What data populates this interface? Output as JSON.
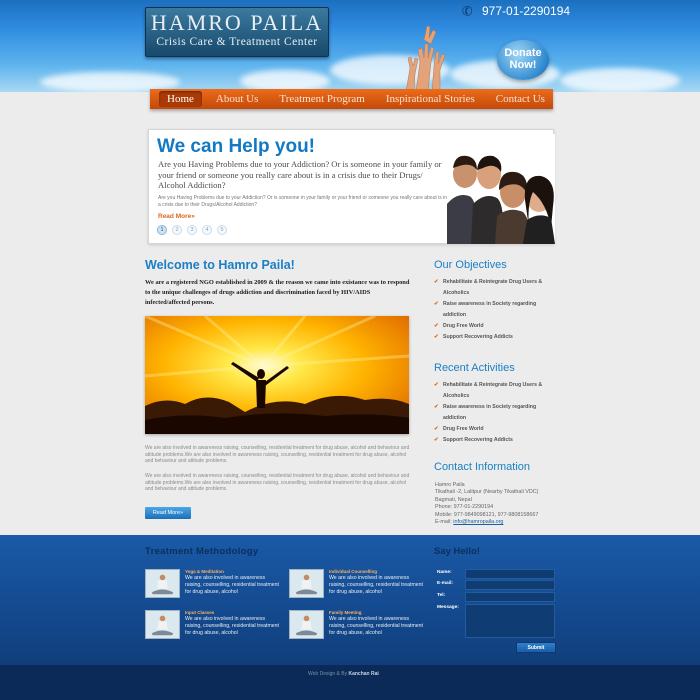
{
  "header": {
    "logo_title": "HAMRO PAILA",
    "logo_subtitle": "Crisis Care & Treatment Center",
    "phone": "977-01-2290194",
    "donate_label": "Donate Now!"
  },
  "nav": {
    "items": [
      {
        "label": "Home",
        "active": true
      },
      {
        "label": "About Us"
      },
      {
        "label": "Treatment Program"
      },
      {
        "label": "Inspirational Stories"
      },
      {
        "label": "Contact Us"
      }
    ]
  },
  "hero": {
    "title": "We can Help you!",
    "lead": "Are you Having Problems due to your Addiction? Or is someone in your family or your friend or someone you really care about is in a crisis due to their Drugs/ Alcohol Addiction?",
    "small": "Are you Having Problems due to your Addiction? Or is someone in your family or your friend or someone you really care about is in a crisis due to their Drugs/Alcohol Addiction?",
    "read_more": "Read More»",
    "pages": [
      "1",
      "2",
      "3",
      "4",
      "5"
    ]
  },
  "welcome": {
    "title": "Welcome to Hamro Paila!",
    "intro": "We are a registered NGO established in 2009 & the reason we came into existance was to respond to the unique challenges of drugs addiction and discrimination faced by HIV/AIDS infected/affected persons.",
    "para1": "We are also involved in awareness raising, counselling, residential treatment for drug abuse, alcohol and behaviour and attitude problems.We are also involved in awareness raising, counselling, residential treatment for drug abuse, alcohol and behaviour and attitude problems.",
    "para2": "We are also involved in awareness raising, counselling, residential treatment for drug abuse, alcohol and behaviour and attitude problems.We are also involved in awareness raising, counselling, residential treatment for drug abuse, alcohol and behaviour and attitude problems.",
    "read_more": "Read More»"
  },
  "objectives": {
    "title": "Our Objectives",
    "items": [
      "Rehabilitate & Reintegrate Drug Users & Alcoholics",
      "Raise awareness in Society regarding addiction",
      "Drug Free World",
      "Support Recovering Addicts"
    ]
  },
  "activities": {
    "title": "Recent Activities",
    "items": [
      "Rehabilitate & Reintegrate Drug Users & Alcoholics",
      "Raise awareness in Society regarding addiction",
      "Drug Free World",
      "Support Recovering Addicts"
    ]
  },
  "contact": {
    "title": "Contact Information",
    "name": "Hamro Paila",
    "address1": "Tikathali -2, Lalitpur (Nearby Tikathali VDC)",
    "address2": "Bagmati, Nepal",
    "phone": "Phone: 977-01-2290194",
    "mobile": "Mobile: 977-9849098121, 977-9808158667",
    "email_label": "E-mail:",
    "email": "info@hamropaila.org"
  },
  "treatment": {
    "title": "Treatment Methodology",
    "items": [
      {
        "name": "Yoga & Meditation",
        "text": "We are also involved in awareness raising, counselling, residential treatment for drug abuse, alcohol"
      },
      {
        "name": "Individual Counselling",
        "text": "We are also involved in awareness raising, counselling, residential treatment for drug abuse, alcohol"
      },
      {
        "name": "Input Classes",
        "text": "We are also involved in awareness raising, counselling, residential treatment for drug abuse, alcohol"
      },
      {
        "name": "Family Meeting",
        "text": "We are also involved in awareness raising, counselling, residential treatment for drug abuse, alcohol"
      }
    ]
  },
  "say_hello": {
    "title": "Say Hello!",
    "name_label": "Name:",
    "email_label": "E-mail:",
    "tel_label": "Tel:",
    "message_label": "Message:",
    "submit_label": "Submit"
  },
  "footer": {
    "credit_prefix": "Web Design & By",
    "credit_name": "Kanchan Rai"
  },
  "colors": {
    "accent_blue": "#1a7fc6",
    "nav_orange": "#e0600f",
    "bottom_blue": "#14498e",
    "footer_navy": "#0b2a57"
  }
}
